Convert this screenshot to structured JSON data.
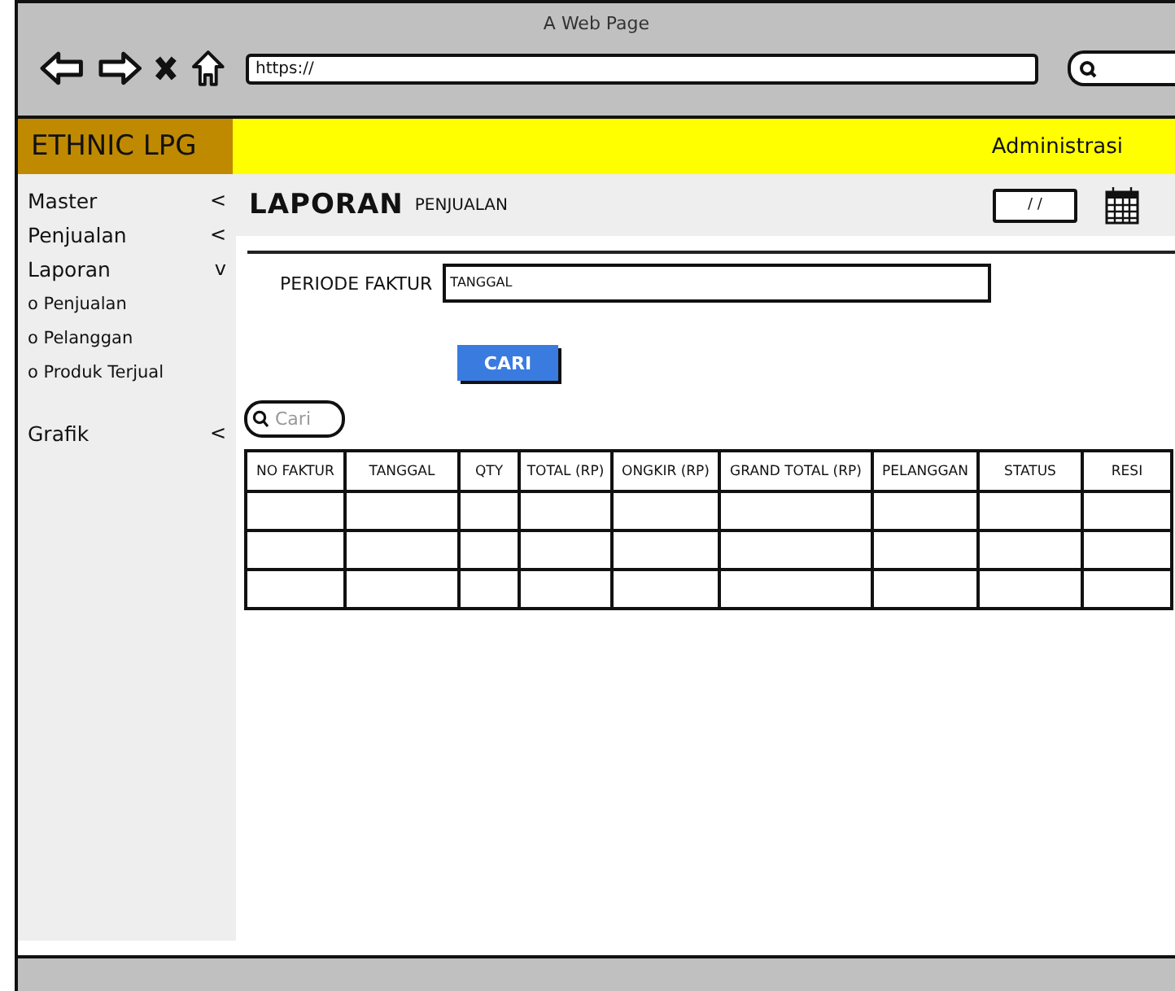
{
  "window": {
    "title": "A Web Page",
    "address": "https://"
  },
  "header": {
    "logo": "ETHNIC LPG",
    "user": "Administrasi"
  },
  "sidebar": {
    "items": [
      {
        "label": "Master",
        "caret": "<"
      },
      {
        "label": "Penjualan",
        "caret": "<"
      },
      {
        "label": "Laporan",
        "caret": "v",
        "children": [
          {
            "label": "o Penjualan"
          },
          {
            "label": "o Pelanggan"
          },
          {
            "label": "o Produk Terjual"
          }
        ]
      },
      {
        "label": "Grafik",
        "caret": "<"
      }
    ]
  },
  "page": {
    "title": "LAPORAN",
    "subtitle": "PENJUALAN",
    "date": "/ /"
  },
  "filter": {
    "label": "PERIODE FAKTUR",
    "value": "TANGGAL",
    "button": "CARI"
  },
  "search": {
    "placeholder": "Cari"
  },
  "table": {
    "columns": [
      "NO FAKTUR",
      "TANGGAL",
      "QTY",
      "TOTAL (RP)",
      "ONGKIR (RP)",
      "GRAND TOTAL (RP)",
      "PELANGGAN",
      "STATUS",
      "RESI"
    ],
    "rows": [
      {
        "kind": "blank"
      },
      {
        "kind": "blank"
      },
      {
        "kind": "blank"
      }
    ]
  }
}
